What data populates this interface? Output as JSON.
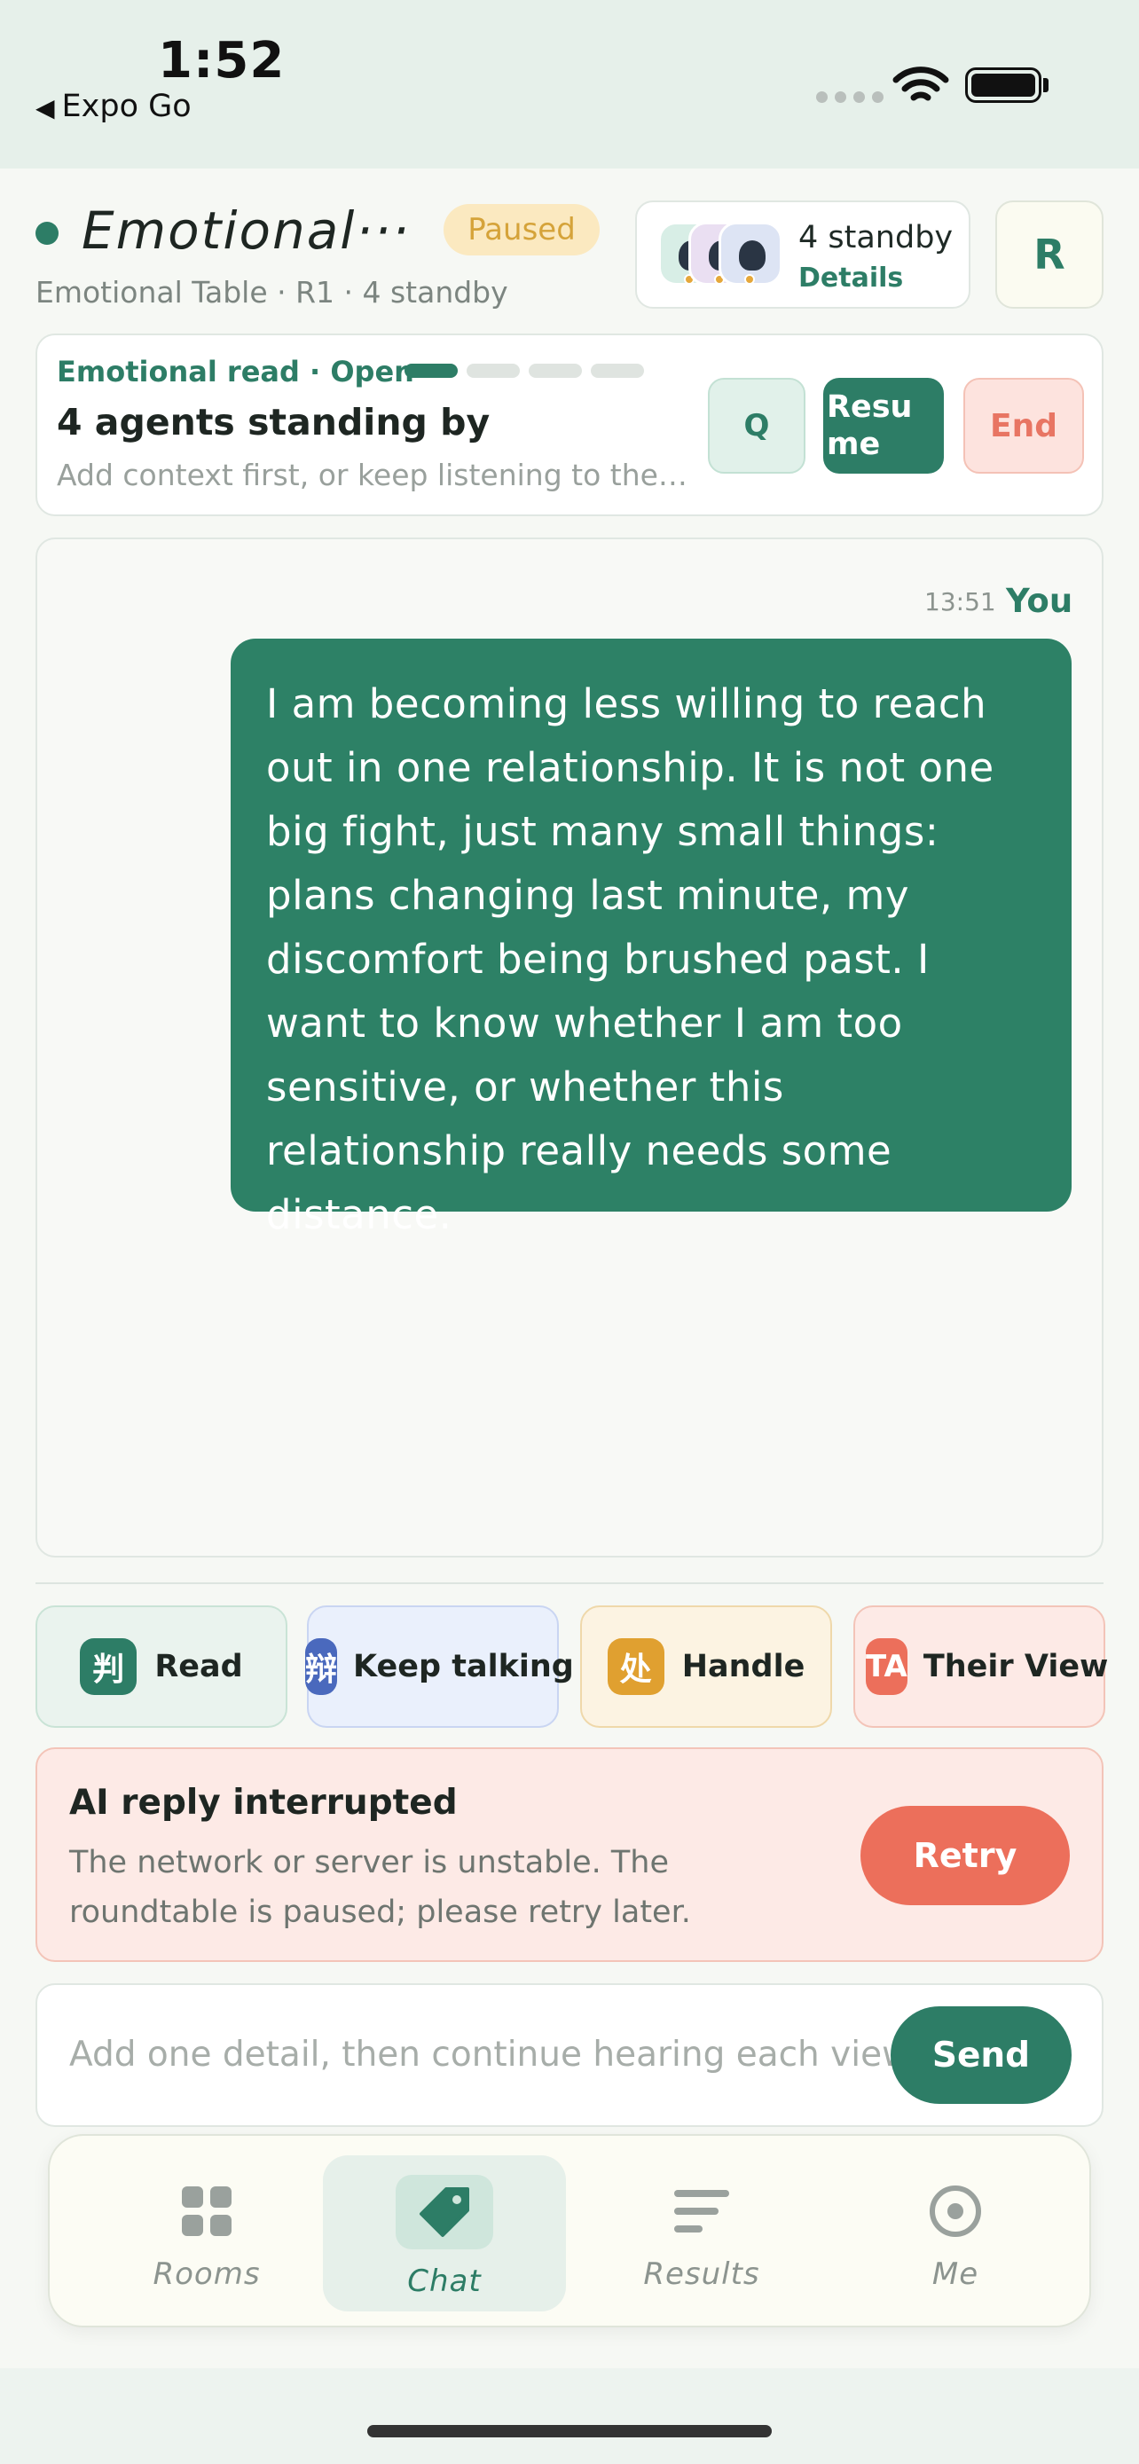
{
  "status_bar": {
    "time": "1:52",
    "back_app": "Expo Go",
    "back_glyph": "◀"
  },
  "header": {
    "title": "Emotional···",
    "state_badge": "Paused",
    "subtitle": "Emotional Table · R1 · 4 standby",
    "standby_count": "4 standby",
    "standby_details": "Details",
    "profile_initial": "R"
  },
  "read_panel": {
    "label": "Emotional read · Open",
    "progress": {
      "completed": 1,
      "total": 4
    },
    "headline": "4 agents standing by",
    "hint": "Add context first, or keep listening to the agents",
    "buttons": {
      "q": "Q",
      "resume": "Resume",
      "end": "End"
    }
  },
  "chat": {
    "messages": [
      {
        "time": "13:51",
        "author": "You",
        "text": "I am becoming less willing to reach out in one relationship. It is not one big fight, just many small things: plans changing last minute, my discomfort being brushed past. I want to know whether I am too sensitive, or whether this relationship really needs some distance."
      }
    ]
  },
  "quick_actions": [
    {
      "badge": "判",
      "label": "Read",
      "color": "#2d7d66"
    },
    {
      "badge": "辩",
      "label": "Keep talking",
      "color": "#4a69bd"
    },
    {
      "badge": "处",
      "label": "Handle",
      "color": "#e0a030"
    },
    {
      "badge": "TA",
      "label": "Their View",
      "color": "#ec6f5b"
    }
  ],
  "error": {
    "title": "AI reply interrupted",
    "body": "The network or server is unstable. The roundtable is paused; please retry later.",
    "retry": "Retry"
  },
  "composer": {
    "placeholder": "Add one detail, then continue hearing each view",
    "value": "",
    "send": "Send"
  },
  "tabs": [
    {
      "label": "Rooms",
      "icon": "grid-icon",
      "active": false
    },
    {
      "label": "Chat",
      "icon": "tag-icon",
      "active": true
    },
    {
      "label": "Results",
      "icon": "list-icon",
      "active": false
    },
    {
      "label": "Me",
      "icon": "target-icon",
      "active": false
    }
  ],
  "colors": {
    "primary": "#2d7d66",
    "paused": "#d5a33a",
    "danger": "#ec6f5b",
    "background": "#f6f8f4"
  }
}
